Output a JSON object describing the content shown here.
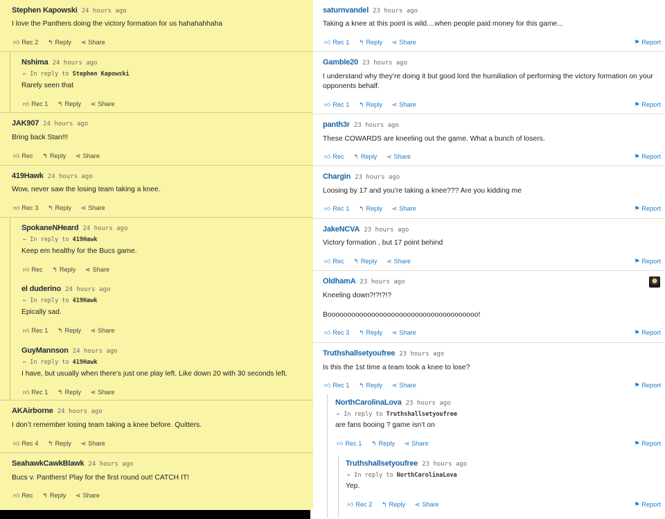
{
  "left": [
    {
      "author": "Stephen Kapowski",
      "time": "24 hours ago",
      "text": "I love the Panthers doing the victory formation for us hahahahhaha",
      "rec": "Rec 2",
      "reply": "Reply",
      "share": "Share"
    },
    {
      "author": "Nshima",
      "time": "24 hours ago",
      "in_reply_prefix": "In reply to",
      "in_reply_to": "Stephen Kapowski",
      "text": "Rarely seen that",
      "rec": "Rec 1",
      "reply": "Reply",
      "share": "Share"
    },
    {
      "author": "JAK907",
      "time": "24 hours ago",
      "text": "Bring back Stan!!!",
      "rec": "Rec",
      "reply": "Reply",
      "share": "Share"
    },
    {
      "author": "419Hawk",
      "time": "24 hours ago",
      "text": "Wow, never saw the losing team taking a knee.",
      "rec": "Rec 3",
      "reply": "Reply",
      "share": "Share"
    },
    {
      "author": "SpokaneNHeard",
      "time": "24 hours ago",
      "in_reply_prefix": "In reply to",
      "in_reply_to": "419Hawk",
      "text": "Keep em healthy for the Bucs game.",
      "rec": "Rec",
      "reply": "Reply",
      "share": "Share"
    },
    {
      "author": "el duderino",
      "time": "24 hours ago",
      "in_reply_prefix": "In reply to",
      "in_reply_to": "419Hawk",
      "text": "Epically sad.",
      "rec": "Rec 1",
      "reply": "Reply",
      "share": "Share"
    },
    {
      "author": "GuyMannson",
      "time": "24 hours ago",
      "in_reply_prefix": "In reply to",
      "in_reply_to": "419Hawk",
      "text": "I have, but usually when there’s just one play left. Like down 20 with 30 seconds left.",
      "rec": "Rec 1",
      "reply": "Reply",
      "share": "Share"
    },
    {
      "author": "AKAirborne",
      "time": "24 hours ago",
      "text": "I don’t remember losing team taking a knee before. Quitters.",
      "rec": "Rec 4",
      "reply": "Reply",
      "share": "Share"
    },
    {
      "author": "SeahawkCawkBlawk",
      "time": "24 hours ago",
      "text": "Bucs v. Panthers! Play for the first round out! CATCH IT!",
      "rec": "Rec",
      "reply": "Reply",
      "share": "Share"
    }
  ],
  "right": [
    {
      "author": "saturnvandel",
      "time": "23 hours ago",
      "text": "Taking a knee at this point is wild....when people paid money for this game...",
      "rec": "Rec 1",
      "reply": "Reply",
      "share": "Share",
      "report": "Report"
    },
    {
      "author": "Gamble20",
      "time": "23 hours ago",
      "text": "I understand why they’re doing it but good lord the humiliation of performing the victory formation on your opponents behalf.",
      "rec": "Rec 1",
      "reply": "Reply",
      "share": "Share",
      "report": "Report"
    },
    {
      "author": "panth3r",
      "time": "23 hours ago",
      "text": "These COWARDS are kneeling out the game. What a bunch of losers.",
      "rec": "Rec",
      "reply": "Reply",
      "share": "Share",
      "report": "Report"
    },
    {
      "author": "Chargin",
      "time": "23 hours ago",
      "text": "Loosing by 17 and you’re taking a knee??? Are you kidding me",
      "rec": "Rec 1",
      "reply": "Reply",
      "share": "Share",
      "report": "Report"
    },
    {
      "author": "JakeNCVA",
      "time": "23 hours ago",
      "text": "Victory formation , but 17 point behind",
      "rec": "Rec",
      "reply": "Reply",
      "share": "Share",
      "report": "Report"
    },
    {
      "author": "OldhamA",
      "time": "23 hours ago",
      "text": "Kneeling down?!?!?!?",
      "text2": "Boooooooooooooooooooooooooooooooooooooo!",
      "rec": "Rec 3",
      "reply": "Reply",
      "share": "Share",
      "report": "Report"
    },
    {
      "author": "Truthshallsetyoufree",
      "time": "23 hours ago",
      "text": "Is this the 1st time a team took a knee to lose?",
      "rec": "Rec 1",
      "reply": "Reply",
      "share": "Share",
      "report": "Report"
    },
    {
      "author": "NorthCarolinaLova",
      "time": "23 hours ago",
      "in_reply_prefix": "In reply to",
      "in_reply_to": "Truthshallsetyoufree",
      "text": "are fans booing ? game isn’t on",
      "rec": "Rec 1",
      "reply": "Reply",
      "share": "Share",
      "report": "Report"
    },
    {
      "author": "Truthshallsetyoufree",
      "time": "23 hours ago",
      "in_reply_prefix": "In reply to",
      "in_reply_to": "NorthCarolinaLova",
      "text": "Yep.",
      "rec": "Rec 2",
      "reply": "Reply",
      "share": "Share",
      "report": "Report"
    }
  ],
  "icons": {
    "rec": "thumbs-up-icon",
    "reply": "reply-arrow-icon",
    "share": "share-icon",
    "report": "flag-icon",
    "in_reply": "back-arrow-icon"
  },
  "colors": {
    "left_bg": "#f9f4a6",
    "link_blue": "#1e7bc9",
    "author_blue": "#1565a8"
  }
}
